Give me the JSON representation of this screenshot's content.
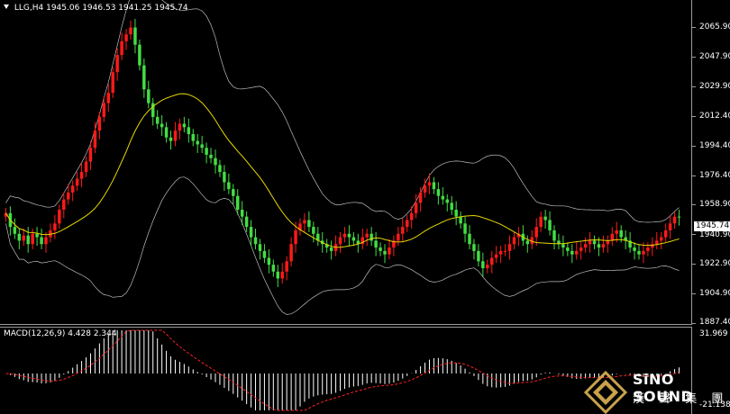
{
  "header": {
    "symbol": "LLG,H4",
    "open": "1945.06",
    "high": "1946.53",
    "low": "1941.25",
    "close": "1945.74"
  },
  "price_axis": {
    "labels": [
      "2065.90",
      "2047.90",
      "2029.90",
      "2012.40",
      "1994.40",
      "1976.40",
      "1958.90",
      "1940.90",
      "1922.90",
      "1904.90",
      "1887.40"
    ],
    "current_price": "1945.74"
  },
  "macd": {
    "title": "MACD(12,26,9) 4.428 2.344",
    "axis_labels": [
      "31.969",
      "-21.138"
    ]
  },
  "logo": {
    "name": "SiNO SOUND",
    "chinese": "漢 聲 集 團"
  },
  "colors": {
    "up_candle": "#ff1a1a",
    "down_candle": "#44dd44",
    "ma_line": "#e6d800",
    "bands": "#bdbdbd",
    "macd_hist": "#ffffff",
    "macd_signal": "#ff2020",
    "background": "#000000"
  },
  "chart_data": {
    "type": "candlestick",
    "ylim": [
      1883,
      2072
    ],
    "closes": [
      1948,
      1940,
      1936,
      1932,
      1935,
      1930,
      1936,
      1934,
      1930,
      1934,
      1938,
      1942,
      1950,
      1956,
      1960,
      1964,
      1968,
      1972,
      1978,
      1986,
      1996,
      2004,
      2012,
      2018,
      2030,
      2040,
      2048,
      2052,
      2056,
      2046,
      2034,
      2020,
      2012,
      2004,
      2000,
      1998,
      1992,
      1990,
      1996,
      2000,
      1998,
      1994,
      1990,
      1988,
      1986,
      1982,
      1980,
      1976,
      1972,
      1966,
      1962,
      1958,
      1950,
      1946,
      1940,
      1934,
      1930,
      1926,
      1922,
      1918,
      1914,
      1910,
      1914,
      1920,
      1930,
      1938,
      1942,
      1944,
      1940,
      1936,
      1932,
      1930,
      1928,
      1926,
      1930,
      1934,
      1936,
      1934,
      1932,
      1930,
      1934,
      1936,
      1932,
      1928,
      1926,
      1924,
      1928,
      1932,
      1936,
      1940,
      1944,
      1948,
      1954,
      1960,
      1964,
      1966,
      1962,
      1958,
      1956,
      1954,
      1950,
      1946,
      1942,
      1936,
      1930,
      1926,
      1920,
      1916,
      1918,
      1922,
      1924,
      1926,
      1926,
      1930,
      1934,
      1936,
      1932,
      1930,
      1934,
      1940,
      1946,
      1944,
      1938,
      1932,
      1930,
      1928,
      1926,
      1924,
      1926,
      1928,
      1930,
      1932,
      1930,
      1928,
      1930,
      1932,
      1936,
      1938,
      1934,
      1932,
      1928,
      1926,
      1924,
      1926,
      1928,
      1930,
      1932,
      1934,
      1938,
      1942,
      1946,
      1945.74
    ],
    "bands_upper": "approx",
    "macd_range": [
      -21.138,
      31.969
    ],
    "macd_value": 4.428,
    "macd_signal_value": 2.344
  }
}
